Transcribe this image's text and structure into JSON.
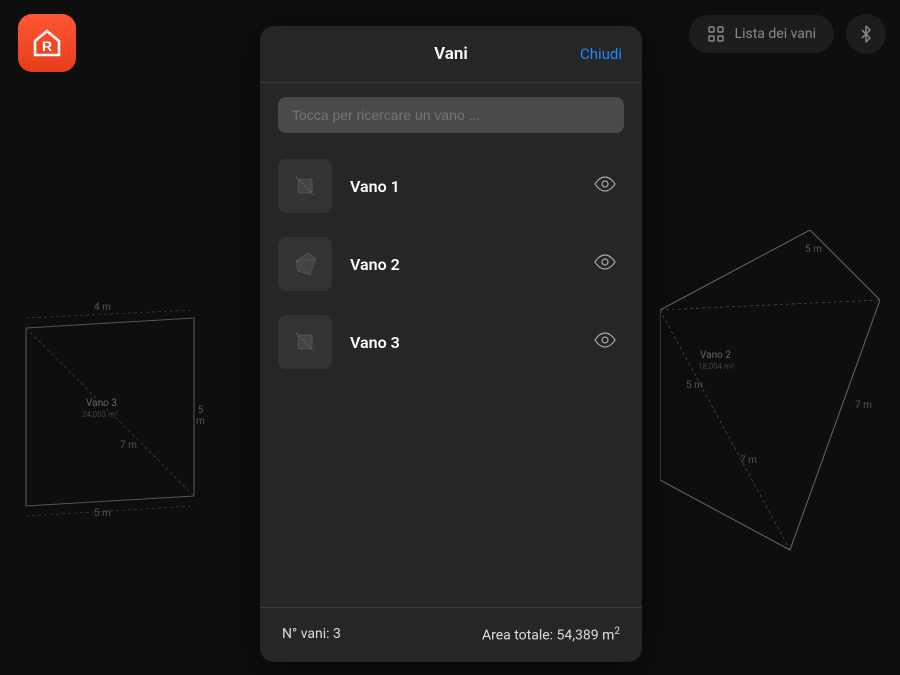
{
  "toolbar": {
    "list_label": "Lista dei vani"
  },
  "modal": {
    "title": "Vani",
    "close_label": "Chiudi",
    "search_placeholder": "Tocca per ricercare un vano ..."
  },
  "rooms": [
    {
      "name": "Vano 1"
    },
    {
      "name": "Vano 2"
    },
    {
      "name": "Vano 3"
    }
  ],
  "footer": {
    "count_label": "N° vani: 3",
    "area_label": "Area totale: 54,389 m",
    "area_exponent": "2"
  },
  "background": {
    "left_room": {
      "name": "Vano 3",
      "area": "24,003 m²",
      "dim_top": "4 m",
      "dim_right": "5 m",
      "dim_bottom": "5 m",
      "dim_diag": "7 m"
    },
    "right_room": {
      "name": "Vano 2",
      "area": "18,004 m²",
      "dim_top": "5 m",
      "dim_right": "7 m",
      "dim_inner": "5 m",
      "dim_diag": "7 m"
    }
  }
}
